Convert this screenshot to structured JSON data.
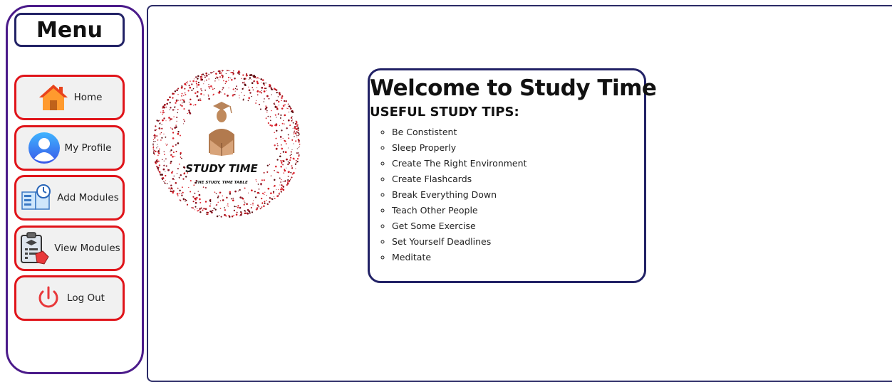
{
  "sidebar": {
    "title": "Menu",
    "items": [
      {
        "label": "Home",
        "icon": "home-icon"
      },
      {
        "label": "My Profile",
        "icon": "user-icon"
      },
      {
        "label": "Add Modules",
        "icon": "book-clock-icon"
      },
      {
        "label": "View Modules",
        "icon": "clipboard-hand-icon"
      },
      {
        "label": "Log Out",
        "icon": "power-icon"
      }
    ]
  },
  "logo": {
    "title": "STUDY TIME",
    "tagline": "THE STUDY, TIME TABLE"
  },
  "welcome": {
    "title": "Welcome to Study Time",
    "tips_heading": "USEFUL STUDY TIPS:",
    "tips": [
      "Be Constistent",
      "Sleep Properly",
      "Create The Right Environment",
      "Create Flashcards",
      "Break Everything Down",
      "Teach Other People",
      "Get Some Exercise",
      "Set Yourself Deadlines",
      "Meditate"
    ]
  },
  "colors": {
    "sidebar_border": "#4b1b8a",
    "button_border": "#e0141a",
    "box_border": "#222266",
    "button_bg": "#f1f1f1"
  }
}
